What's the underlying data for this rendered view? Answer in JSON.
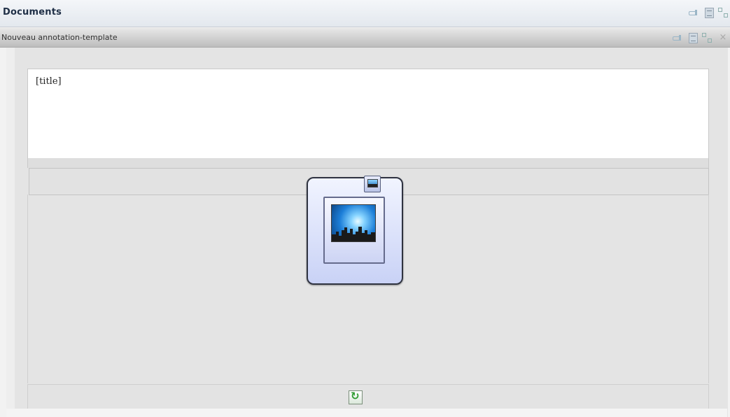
{
  "outer_panel": {
    "title": "Documents"
  },
  "tab": {
    "title": "Nouveau annotation-template"
  },
  "editor": {
    "title_placeholder": "[title]"
  },
  "icons": {
    "header": [
      "pin-icon",
      "document-icon",
      "maximize-icon"
    ],
    "tab": [
      "pin-icon",
      "document-icon",
      "maximize-icon",
      "close-icon"
    ],
    "image_placeholder": "image-icon",
    "image_small": "image-small-icon",
    "footer": "refresh-icon"
  },
  "colors": {
    "accent_blue": "#1c7ed8",
    "frame_dark": "#2f3340",
    "refresh_green": "#2f9b32"
  }
}
